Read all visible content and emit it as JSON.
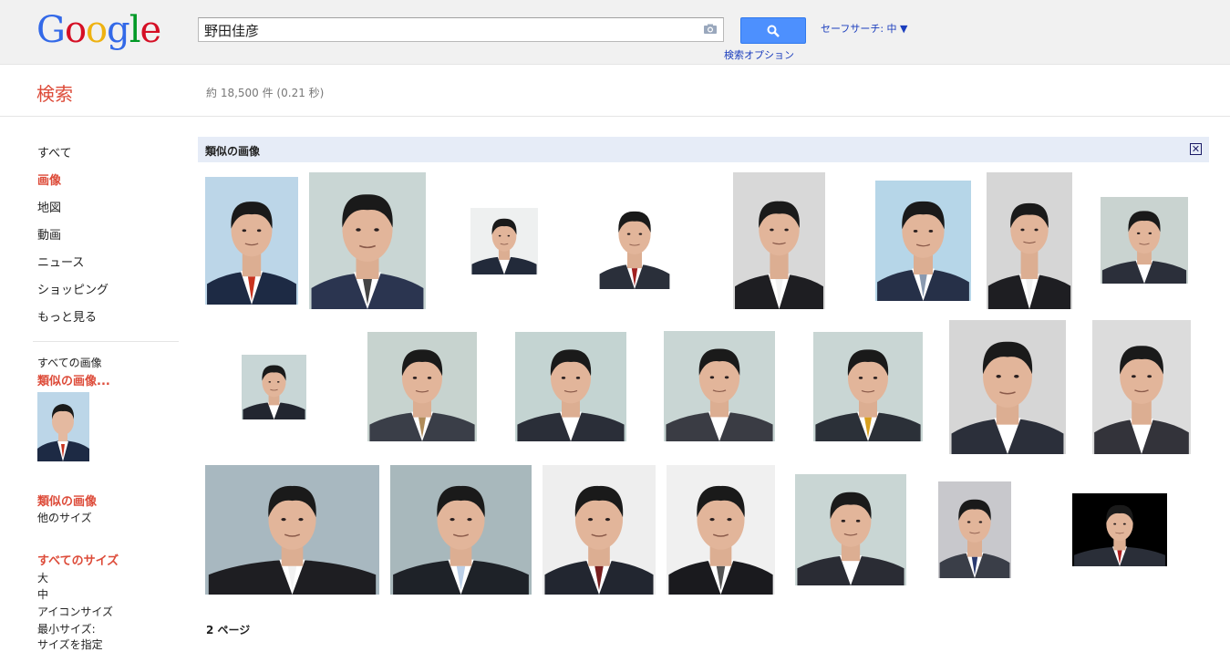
{
  "logo": {
    "letters": [
      "G",
      "o",
      "o",
      "g",
      "l",
      "e"
    ]
  },
  "search": {
    "query": "野田佳彦",
    "button_icon": "search-icon",
    "adv_label": "検索オプション",
    "safe_label": "セーフサーチ: 中 ▼"
  },
  "subbar": {
    "title": "検索",
    "stats": "約 18,500 件 (0.21 秒)"
  },
  "sidebar": {
    "items": [
      {
        "label": "すべて"
      },
      {
        "label": "画像"
      },
      {
        "label": "地図"
      },
      {
        "label": "動画"
      },
      {
        "label": "ニュース"
      },
      {
        "label": "ショッピング"
      },
      {
        "label": "もっと見る"
      }
    ],
    "all_images": "すべての画像",
    "similar_dots": "類似の画像...",
    "similar": "類似の画像",
    "other_sizes": "他のサイズ",
    "all_sizes": "すべてのサイズ",
    "sizes": [
      "大",
      "中",
      "アイコンサイズ",
      "最小サイズ:",
      "サイズを指定"
    ]
  },
  "similar": {
    "header": "類似の画像",
    "close_symbol": "✕"
  },
  "images": [
    {
      "bg": "#bcd6e8",
      "suit": "#1d2a44",
      "tie": "#c8331f"
    },
    {
      "bg": "#c9d6d4",
      "suit": "#2b3550",
      "tie": "#444444"
    },
    {
      "bg": "#eef0f0",
      "suit": "#222a3a",
      "tie": "#ffffff"
    },
    {
      "bg": "#ffffff",
      "suit": "#2a2f3a",
      "tie": "#a02020"
    },
    {
      "bg": "#d8d8d8",
      "suit": "#1e1e22",
      "tie": "#f2f2f2"
    },
    {
      "bg": "#b6d6e8",
      "suit": "#263048",
      "tie": "#8a9ab0"
    },
    {
      "bg": "#d6d6d6",
      "suit": "#1e1e22",
      "tie": "#f2f2f2"
    },
    {
      "bg": "#c9d3d0",
      "suit": "#2b2f3a",
      "tie": "#ffffff"
    },
    {
      "bg": "#c8d6d6",
      "suit": "#222630",
      "tie": "#ffffff"
    },
    {
      "bg": "#c7d3cf",
      "suit": "#3a3e48",
      "tie": "#b08c5a"
    },
    {
      "bg": "#c4d4d2",
      "suit": "#2a2e38",
      "tie": "#ffffff"
    },
    {
      "bg": "#c9d6d4",
      "suit": "#3a3c44",
      "tie": "#ffffff"
    },
    {
      "bg": "#c9d6d4",
      "suit": "#2b3038",
      "tie": "#d8a020"
    },
    {
      "bg": "#d6d6d6",
      "suit": "#2b2f3a",
      "tie": "#ffffff"
    },
    {
      "bg": "#dcdcdc",
      "suit": "#33333a",
      "tie": "#ffffff"
    },
    {
      "bg": "#a8b8c0",
      "suit": "#1e1e22",
      "tie": "#f2f2f2"
    },
    {
      "bg": "#a8b8bc",
      "suit": "#1e2228",
      "tie": "#bcd0e8"
    },
    {
      "bg": "#eeeeee",
      "suit": "#222630",
      "tie": "#7a2020"
    },
    {
      "bg": "#f0f0f0",
      "suit": "#1a1a1e",
      "tie": "#555555"
    },
    {
      "bg": "#c9d6d4",
      "suit": "#2a2c34",
      "tie": "#ffffff"
    },
    {
      "bg": "#c8c8cc",
      "suit": "#3a3e48",
      "tie": "#2a3a70"
    },
    {
      "bg": "#000000",
      "suit": "#2a2e38",
      "tie": "#b02020"
    }
  ],
  "pager": {
    "label": "2 ページ"
  }
}
